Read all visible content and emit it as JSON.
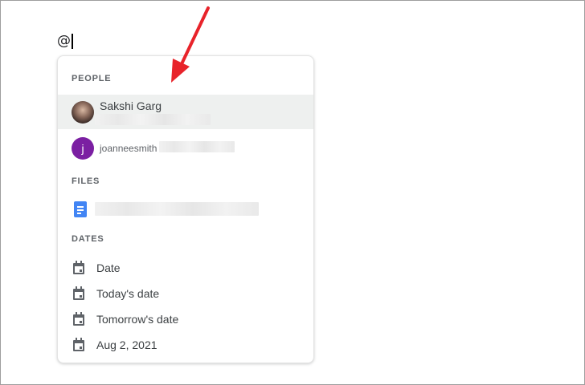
{
  "document": {
    "typed_text": "@"
  },
  "menu": {
    "people_header": "PEOPLE",
    "people": [
      {
        "name": "Sakshi Garg",
        "avatar_icon": "person-photo-avatar",
        "email_hidden": true
      },
      {
        "avatar_letter": "j",
        "avatar_color": "#7b1fa2",
        "email": "joanneesmith"
      }
    ],
    "files_header": "FILES",
    "files": [
      {
        "icon": "google-docs-icon",
        "name_hidden": true
      }
    ],
    "dates_header": "DATES",
    "dates": [
      {
        "label": "Date",
        "icon": "calendar-icon"
      },
      {
        "label": "Today's date",
        "icon": "calendar-icon"
      },
      {
        "label": "Tomorrow's date",
        "icon": "calendar-icon"
      },
      {
        "label": "Aug 2, 2021",
        "icon": "calendar-icon"
      }
    ]
  },
  "colors": {
    "highlight_row": "#eef0ef",
    "arrow": "#e8232a",
    "docs_blue": "#4285f4"
  }
}
